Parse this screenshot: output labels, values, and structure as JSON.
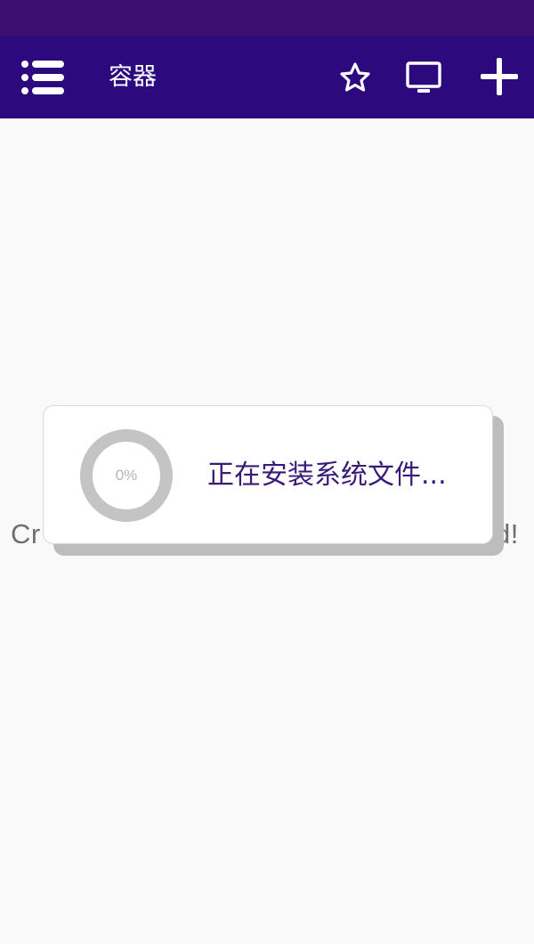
{
  "appbar": {
    "title": "容器",
    "actions": [
      {
        "name": "favorite",
        "icon": "star-outline-icon"
      },
      {
        "name": "display",
        "icon": "monitor-icon"
      },
      {
        "name": "add",
        "icon": "plus-icon"
      }
    ],
    "menu_icon": "list-menu-icon"
  },
  "content": {
    "background_text_left": "Cr",
    "background_text_right": "d!"
  },
  "dialog": {
    "progress_percent": 0,
    "progress_label": "0%",
    "message": "正在安装系统文件..."
  },
  "colors": {
    "status_bar": "#3a0f6e",
    "app_bar": "#2c0a7e",
    "message_text": "#3a1a78",
    "progress_ring": "#bdbdbd"
  }
}
